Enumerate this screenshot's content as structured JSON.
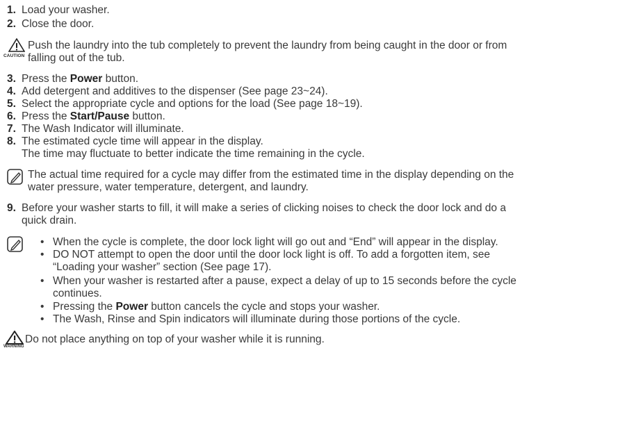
{
  "steps_a": [
    {
      "num": "1.",
      "text": "Load your washer."
    },
    {
      "num": "2.",
      "text": "Close the door."
    }
  ],
  "caution": {
    "icon_label": "CAUTION",
    "line1": "Push the laundry into the tub completely to prevent the laundry from being caught in the door or from",
    "line2": "falling out of the tub."
  },
  "steps_b": [
    {
      "num": "3.",
      "pre": "Press the ",
      "bold": "Power",
      "post": " button."
    },
    {
      "num": "4.",
      "pre": "Add detergent and additives to the dispenser (See page 23~24).",
      "bold": "",
      "post": ""
    },
    {
      "num": "5.",
      "pre": "Select the appropriate cycle and options for the load (See page 18~19).",
      "bold": "",
      "post": ""
    },
    {
      "num": "6.",
      "pre": "Press the ",
      "bold": "Start/Pause",
      "post": " button."
    },
    {
      "num": "7.",
      "pre": "The Wash Indicator will illuminate.",
      "bold": "",
      "post": ""
    },
    {
      "num": "8.",
      "pre": "The estimated cycle time will appear in the display.",
      "bold": "",
      "post": ""
    }
  ],
  "step8_cont": "The time may fluctuate to better indicate the time remaining in the cycle.",
  "note1": {
    "line1": "The actual time required for a cycle may differ from the estimated time in the display depending on the",
    "line2": "water pressure, water temperature, detergent, and laundry."
  },
  "step9": {
    "num": "9.",
    "line1": "Before your washer starts to fill, it will make a series of clicking noises to check the door lock and do a",
    "line2": "quick drain."
  },
  "note2": {
    "bullet_char": "•",
    "b1": "When the cycle is complete, the door lock light will go out and “End” will appear in the display.",
    "b2_line1": "DO NOT attempt to open the door until the door lock light is off. To add a forgotten item, see",
    "b2_line2": "“Loading your washer” section (See page 17).",
    "b3_line1": "When your washer is restarted after a pause, expect a delay of up to 15 seconds before the cycle",
    "b3_line2": "continues.",
    "b4_pre": "Pressing the ",
    "b4_bold": "Power",
    "b4_post": " button cancels the cycle and stops your washer.",
    "b5": "The Wash, Rinse and Spin indicators will illuminate during those portions of the cycle."
  },
  "warning": {
    "icon_label": "WARNING",
    "text": "Do not place anything on top of your washer while it is running."
  }
}
